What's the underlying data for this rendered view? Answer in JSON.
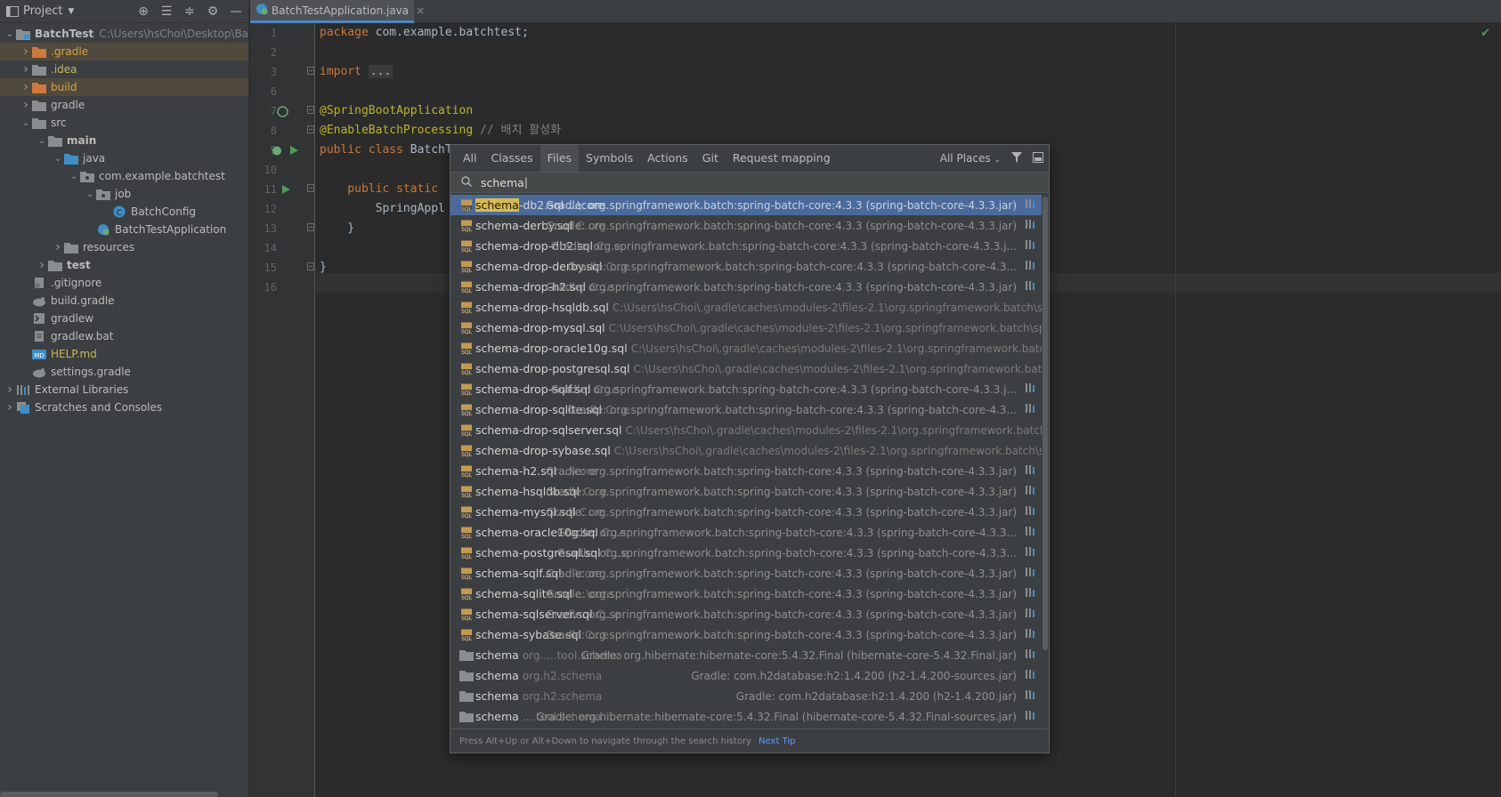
{
  "project_panel": {
    "title": "Project",
    "tree": [
      {
        "label": "BatchTest",
        "hint": "C:\\Users\\hsChoi\\Desktop\\Bat",
        "depth": 0,
        "arrow": "open",
        "icon": "module-folder-icon",
        "bold": true
      },
      {
        "label": ".gradle",
        "depth": 1,
        "arrow": "closed",
        "icon": "orange-folder-icon",
        "style": "orange",
        "hl": true
      },
      {
        "label": ".idea",
        "depth": 1,
        "arrow": "closed",
        "icon": "folder-icon",
        "style": "yellow"
      },
      {
        "label": "build",
        "depth": 1,
        "arrow": "closed",
        "icon": "orange-folder-icon",
        "style": "orange",
        "hl": true
      },
      {
        "label": "gradle",
        "depth": 1,
        "arrow": "closed",
        "icon": "folder-icon"
      },
      {
        "label": "src",
        "depth": 1,
        "arrow": "open",
        "icon": "folder-icon"
      },
      {
        "label": "main",
        "depth": 2,
        "arrow": "open",
        "icon": "folder-icon",
        "bold": true
      },
      {
        "label": "java",
        "depth": 3,
        "arrow": "open",
        "icon": "source-folder-icon"
      },
      {
        "label": "com.example.batchtest",
        "depth": 4,
        "arrow": "open",
        "icon": "package-icon"
      },
      {
        "label": "job",
        "depth": 5,
        "arrow": "open",
        "icon": "package-icon"
      },
      {
        "label": "BatchConfig",
        "depth": 6,
        "arrow": "none",
        "icon": "class-icon"
      },
      {
        "label": "BatchTestApplication",
        "depth": 5,
        "arrow": "none",
        "icon": "spring-class-icon"
      },
      {
        "label": "resources",
        "depth": 3,
        "arrow": "closed",
        "icon": "folder-icon"
      },
      {
        "label": "test",
        "depth": 2,
        "arrow": "closed",
        "icon": "folder-icon",
        "bold": true
      },
      {
        "label": ".gitignore",
        "depth": 1,
        "arrow": "none",
        "icon": "gitignore-icon"
      },
      {
        "label": "build.gradle",
        "depth": 1,
        "arrow": "none",
        "icon": "gradle-icon"
      },
      {
        "label": "gradlew",
        "depth": 1,
        "arrow": "none",
        "icon": "shell-icon"
      },
      {
        "label": "gradlew.bat",
        "depth": 1,
        "arrow": "none",
        "icon": "text-file-icon"
      },
      {
        "label": "HELP.md",
        "depth": 1,
        "arrow": "none",
        "icon": "markdown-icon",
        "style": "yellow"
      },
      {
        "label": "settings.gradle",
        "depth": 1,
        "arrow": "none",
        "icon": "gradle-icon"
      },
      {
        "label": "External Libraries",
        "depth": 0,
        "arrow": "closed",
        "icon": "libraries-icon"
      },
      {
        "label": "Scratches and Consoles",
        "depth": 0,
        "arrow": "closed",
        "icon": "scratches-icon"
      }
    ]
  },
  "editor": {
    "tab_label": "BatchTestApplication.java",
    "tab_close": "×",
    "line_numbers": [
      "1",
      "2",
      "3",
      "6",
      "7",
      "8",
      "9",
      "10",
      "11",
      "12",
      "13",
      "14",
      "15",
      "16"
    ],
    "code": {
      "l1_kw": "package ",
      "l1_rest": "com.example.batchtest;",
      "l3_kw": "import ",
      "l3_fold": "...",
      "l7": "@SpringBootApplication",
      "l8_ann": "@EnableBatchProcessing",
      "l8_cm": " // 배치 활성화",
      "l9_kw": "public class ",
      "l9_rest": "BatchT",
      "l11_kw": "    public static ",
      "l12": "        SpringAppl",
      "l13": "    }",
      "l15": "}"
    }
  },
  "search_popup": {
    "tabs": [
      "All",
      "Classes",
      "Files",
      "Symbols",
      "Actions",
      "Git",
      "Request mapping"
    ],
    "active_tab": "Files",
    "scope": "All Places",
    "query": "schema",
    "footer_text": "Press Alt+Up or Alt+Down to navigate through the search history",
    "footer_link": "Next Tip",
    "results": [
      {
        "match": "schema",
        "rest": "-db2.sql",
        "path": "...\\core",
        "loc": "Gradle: org.springframework.batch:spring-batch-core:4.3.3 (spring-batch-core-4.3.3.jar)",
        "icon": "sql-file-icon",
        "selected": true
      },
      {
        "match": "",
        "rest": "schema-derby.sql",
        "path": "C...re",
        "loc": "Gradle: org.springframework.batch:spring-batch-core:4.3.3 (spring-batch-core-4.3.3.jar)",
        "icon": "sql-file-icon"
      },
      {
        "match": "",
        "rest": "schema-drop-db2.sql",
        "path": "C...e",
        "loc": "Gradle: org.springframework.batch:spring-batch-core:4.3.3 (spring-batch-core-4.3.3.j...",
        "icon": "sql-file-icon"
      },
      {
        "match": "",
        "rest": "schema-drop-derby.sql",
        "path": "C...e",
        "loc": "Gradle: org.springframework.batch:spring-batch-core:4.3.3 (spring-batch-core-4.3...",
        "icon": "sql-file-icon"
      },
      {
        "match": "",
        "rest": "schema-drop-h2.sql",
        "path": "C...e",
        "loc": "Gradle: org.springframework.batch:spring-batch-core:4.3.3 (spring-batch-core-4.3.3.jar)",
        "icon": "sql-file-icon"
      },
      {
        "match": "",
        "rest": "schema-drop-hsqldb.sql",
        "path": "C:\\Users\\hsChoi\\.gradle\\caches\\modules-2\\files-2.1\\org.springframework.batch\\spring-b",
        "loc": "",
        "icon": "sql-file-icon"
      },
      {
        "match": "",
        "rest": "schema-drop-mysql.sql",
        "path": "C:\\Users\\hsChoi\\.gradle\\caches\\modules-2\\files-2.1\\org.springframework.batch\\spring-ba",
        "loc": "",
        "icon": "sql-file-icon"
      },
      {
        "match": "",
        "rest": "schema-drop-oracle10g.sql",
        "path": "C:\\Users\\hsChoi\\.gradle\\caches\\modules-2\\files-2.1\\org.springframework.batch\\spring",
        "loc": "",
        "icon": "sql-file-icon"
      },
      {
        "match": "",
        "rest": "schema-drop-postgresql.sql",
        "path": "C:\\Users\\hsChoi\\.gradle\\caches\\modules-2\\files-2.1\\org.springframework.batch\\sprin",
        "loc": "",
        "icon": "sql-file-icon"
      },
      {
        "match": "",
        "rest": "schema-drop-sqlf.sql",
        "path": "C...e",
        "loc": "Gradle: org.springframework.batch:spring-batch-core:4.3.3 (spring-batch-core-4.3.3.j...",
        "icon": "sql-file-icon"
      },
      {
        "match": "",
        "rest": "schema-drop-sqlite.sql",
        "path": "C...e",
        "loc": "Gradle: org.springframework.batch:spring-batch-core:4.3.3 (spring-batch-core-4.3...",
        "icon": "sql-file-icon"
      },
      {
        "match": "",
        "rest": "schema-drop-sqlserver.sql",
        "path": "C:\\Users\\hsChoi\\.gradle\\caches\\modules-2\\files-2.1\\org.springframework.batch\\spring-",
        "loc": "",
        "icon": "sql-file-icon"
      },
      {
        "match": "",
        "rest": "schema-drop-sybase.sql",
        "path": "C:\\Users\\hsChoi\\.gradle\\caches\\modules-2\\files-2.1\\org.springframework.batch\\spring-b",
        "loc": "",
        "icon": "sql-file-icon"
      },
      {
        "match": "",
        "rest": "schema-h2.sql",
        "path": "...\\core",
        "loc": "Gradle: org.springframework.batch:spring-batch-core:4.3.3 (spring-batch-core-4.3.3.jar)",
        "icon": "sql-file-icon"
      },
      {
        "match": "",
        "rest": "schema-hsqldb.sql",
        "path": "C...e",
        "loc": "Gradle: org.springframework.batch:spring-batch-core:4.3.3 (spring-batch-core-4.3.3.jar)",
        "icon": "sql-file-icon"
      },
      {
        "match": "",
        "rest": "schema-mysql.sql",
        "path": "C...e",
        "loc": "Gradle: org.springframework.batch:spring-batch-core:4.3.3 (spring-batch-core-4.3.3.jar)",
        "icon": "sql-file-icon"
      },
      {
        "match": "",
        "rest": "schema-oracle10g.sql",
        "path": "C...e",
        "loc": "Gradle: org.springframework.batch:spring-batch-core:4.3.3 (spring-batch-core-4.3.3...",
        "icon": "sql-file-icon"
      },
      {
        "match": "",
        "rest": "schema-postgresql.sql",
        "path": "C...e",
        "loc": "Gradle: org.springframework.batch:spring-batch-core:4.3.3 (spring-batch-core-4.3.3...",
        "icon": "sql-file-icon"
      },
      {
        "match": "",
        "rest": "schema-sqlf.sql",
        "path": "...\\core",
        "loc": "Gradle: org.springframework.batch:spring-batch-core:4.3.3 (spring-batch-core-4.3.3.jar)",
        "icon": "sql-file-icon"
      },
      {
        "match": "",
        "rest": "schema-sqlite.sql",
        "path": "...\\core",
        "loc": "Gradle: org.springframework.batch:spring-batch-core:4.3.3 (spring-batch-core-4.3.3.jar)",
        "icon": "sql-file-icon"
      },
      {
        "match": "",
        "rest": "schema-sqlserver.sql",
        "path": "C...e",
        "loc": "Gradle: org.springframework.batch:spring-batch-core:4.3.3 (spring-batch-core-4.3.3.jar)",
        "icon": "sql-file-icon"
      },
      {
        "match": "",
        "rest": "schema-sybase.sql",
        "path": "C...e",
        "loc": "Gradle: org.springframework.batch:spring-batch-core:4.3.3 (spring-batch-core-4.3.3.jar)",
        "icon": "sql-file-icon"
      },
      {
        "match": "",
        "rest": "schema",
        "path": "org.....tool.schema",
        "loc": "Gradle: org.hibernate:hibernate-core:5.4.32.Final (hibernate-core-5.4.32.Final.jar)",
        "icon": "folder-icon"
      },
      {
        "match": "",
        "rest": "schema",
        "path": "org.h2.schema",
        "loc": "Gradle: com.h2database:h2:1.4.200 (h2-1.4.200-sources.jar)",
        "icon": "folder-icon"
      },
      {
        "match": "",
        "rest": "schema",
        "path": "org.h2.schema",
        "loc": "Gradle: com.h2database:h2:1.4.200 (h2-1.4.200.jar)",
        "icon": "folder-icon"
      },
      {
        "match": "",
        "rest": "schema",
        "path": "....tool.schema",
        "loc": "Gradle: org.hibernate:hibernate-core:5.4.32.Final (hibernate-core-5.4.32.Final-sources.jar)",
        "icon": "folder-icon"
      }
    ]
  }
}
